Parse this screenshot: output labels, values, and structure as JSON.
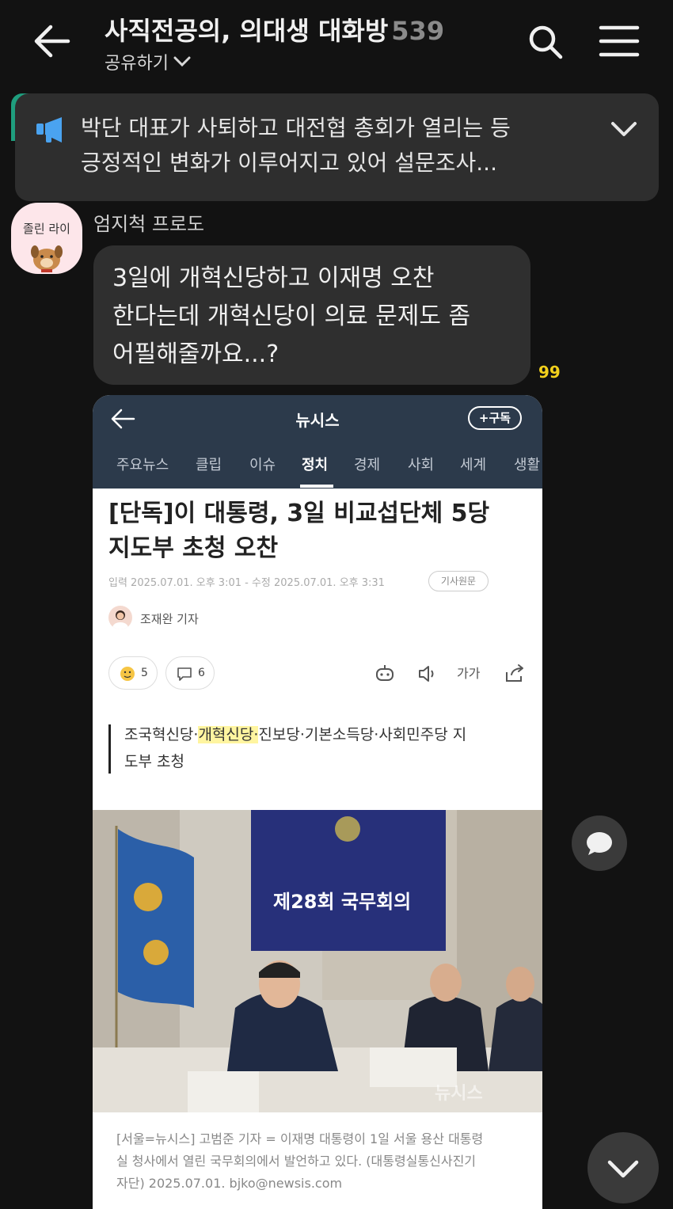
{
  "header": {
    "title": "사직전공의, 의대생 대화방",
    "member_count": "539",
    "share_label": "공유하기"
  },
  "notice": {
    "line1": "박단 대표가 사퇴하고 대전협 총회가 열리는 등",
    "line2": "긍정적인 변화가 이루어지고 있어 설문조사..."
  },
  "message": {
    "avatar_text": "졸린 라이",
    "sender": "엄지척 프로도",
    "lines": [
      "3일에 개혁신당하고 이재명 오찬",
      "한다는데 개혁신당이 의료 문제도 좀",
      "어필해줄까요...?"
    ],
    "unread_count": "99"
  },
  "news": {
    "outlet": "뉴시스",
    "subscribe": "+구독",
    "tabs": [
      "주요뉴스",
      "클립",
      "이슈",
      "정치",
      "경제",
      "사회",
      "세계",
      "생활"
    ],
    "active_tab": "정치",
    "headline": [
      "[단독]이 대통령, 3일 비교섭단체 5당",
      "지도부 초청 오찬"
    ],
    "meta": "입력 2025.07.01. 오후 3:01  -  수정 2025.07.01. 오후 3:31",
    "origin_button": "기사원문",
    "reporter": "조재완 기자",
    "reaction_count": "5",
    "comment_count": "6",
    "font_size_label": "가가",
    "lede_line1_pre": "조국혁신당·",
    "lede_line1_hl": "개혁신당·",
    "lede_line1_post": "진보당·기본소득당·사회민주당 지",
    "lede_line2": "도부 초청",
    "photo_sign": "제28회 국무회의",
    "watermark": "뉴시스",
    "caption": [
      "[서울=뉴시스] 고범준 기자 = 이재명 대통령이 1일 서울 용산 대통령",
      "실 청사에서 열린 국무회의에서 발언하고 있다. (대통령실통신사진기",
      "자단) 2025.07.01. bjko@newsis.com"
    ]
  },
  "colors": {
    "background": "#121212",
    "bubble": "#2f2f2f",
    "notice": "#2e2e2e",
    "unread": "#f2d01c",
    "notice_icon": "#4aa3f0",
    "news_header": "#2c3a4b"
  }
}
